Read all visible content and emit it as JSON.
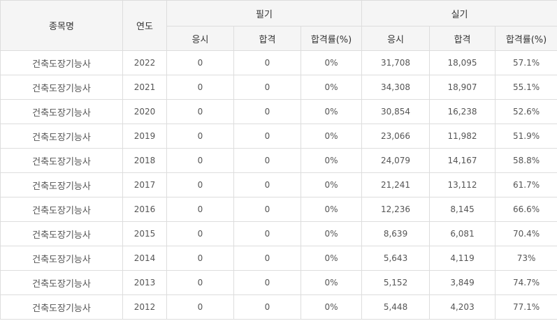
{
  "headers": {
    "subject": "종목명",
    "year": "연도",
    "written": "필기",
    "practical": "실기",
    "applicants": "응시",
    "passed": "합격",
    "rate": "합격률(%)"
  },
  "rows": [
    {
      "name": "건축도장기능사",
      "year": "2022",
      "w_app": "0",
      "w_pass": "0",
      "w_rate": "0%",
      "p_app": "31,708",
      "p_pass": "18,095",
      "p_rate": "57.1%"
    },
    {
      "name": "건축도장기능사",
      "year": "2021",
      "w_app": "0",
      "w_pass": "0",
      "w_rate": "0%",
      "p_app": "34,308",
      "p_pass": "18,907",
      "p_rate": "55.1%"
    },
    {
      "name": "건축도장기능사",
      "year": "2020",
      "w_app": "0",
      "w_pass": "0",
      "w_rate": "0%",
      "p_app": "30,854",
      "p_pass": "16,238",
      "p_rate": "52.6%"
    },
    {
      "name": "건축도장기능사",
      "year": "2019",
      "w_app": "0",
      "w_pass": "0",
      "w_rate": "0%",
      "p_app": "23,066",
      "p_pass": "11,982",
      "p_rate": "51.9%"
    },
    {
      "name": "건축도장기능사",
      "year": "2018",
      "w_app": "0",
      "w_pass": "0",
      "w_rate": "0%",
      "p_app": "24,079",
      "p_pass": "14,167",
      "p_rate": "58.8%"
    },
    {
      "name": "건축도장기능사",
      "year": "2017",
      "w_app": "0",
      "w_pass": "0",
      "w_rate": "0%",
      "p_app": "21,241",
      "p_pass": "13,112",
      "p_rate": "61.7%"
    },
    {
      "name": "건축도장기능사",
      "year": "2016",
      "w_app": "0",
      "w_pass": "0",
      "w_rate": "0%",
      "p_app": "12,236",
      "p_pass": "8,145",
      "p_rate": "66.6%"
    },
    {
      "name": "건축도장기능사",
      "year": "2015",
      "w_app": "0",
      "w_pass": "0",
      "w_rate": "0%",
      "p_app": "8,639",
      "p_pass": "6,081",
      "p_rate": "70.4%"
    },
    {
      "name": "건축도장기능사",
      "year": "2014",
      "w_app": "0",
      "w_pass": "0",
      "w_rate": "0%",
      "p_app": "5,643",
      "p_pass": "4,119",
      "p_rate": "73%"
    },
    {
      "name": "건축도장기능사",
      "year": "2013",
      "w_app": "0",
      "w_pass": "0",
      "w_rate": "0%",
      "p_app": "5,152",
      "p_pass": "3,849",
      "p_rate": "74.7%"
    },
    {
      "name": "건축도장기능사",
      "year": "2012",
      "w_app": "0",
      "w_pass": "0",
      "w_rate": "0%",
      "p_app": "5,448",
      "p_pass": "4,203",
      "p_rate": "77.1%"
    }
  ]
}
